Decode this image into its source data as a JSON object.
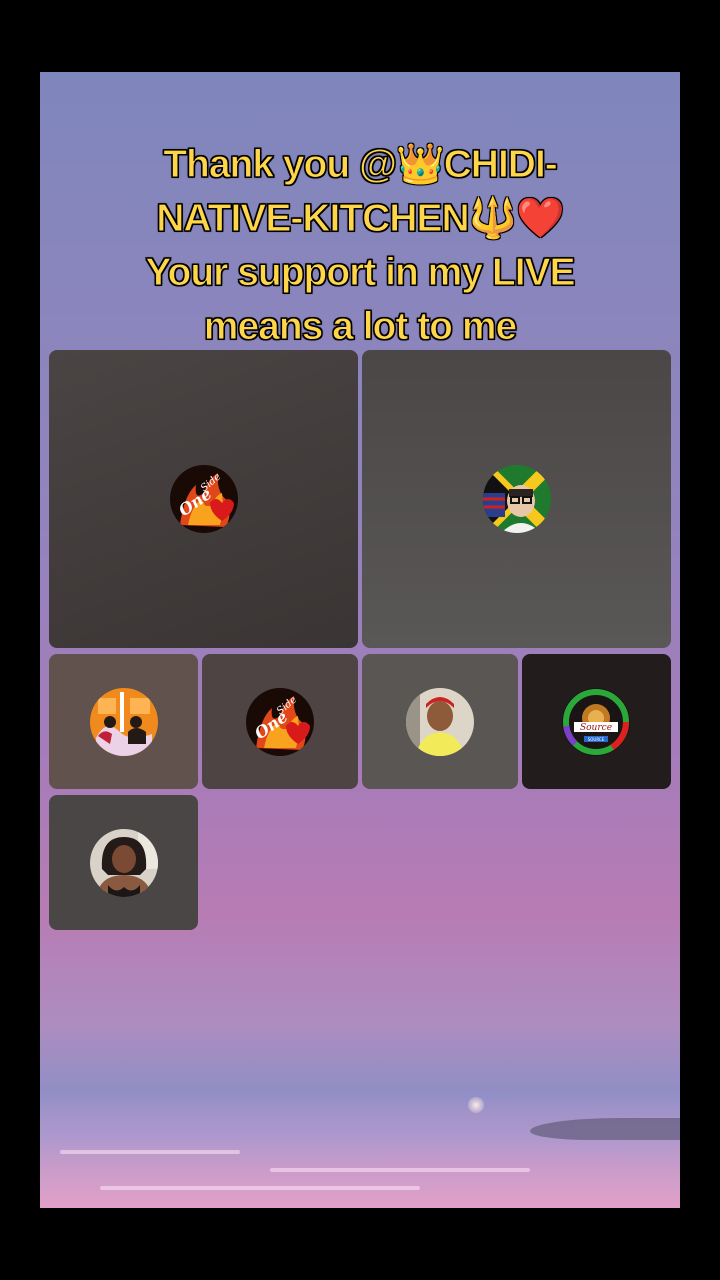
{
  "banner": {
    "line1": "Thank you @👑CHIDI-",
    "line2": "NATIVE-KITCHEN🔱❤️",
    "line3": "Your support in my LIVE",
    "line4": "means a lot to me"
  },
  "guests": [
    {
      "avatar_icon": "one-side-flame-heart-avatar",
      "size": "large"
    },
    {
      "avatar_icon": "flag-portrait-avatar",
      "size": "large"
    },
    {
      "avatar_icon": "couple-silhouette-avatar",
      "size": "small"
    },
    {
      "avatar_icon": "one-side-flame-heart-avatar",
      "size": "small"
    },
    {
      "avatar_icon": "selfie-portrait-avatar",
      "size": "small"
    },
    {
      "avatar_icon": "source-lion-badge-avatar",
      "size": "small"
    },
    {
      "avatar_icon": "woman-portrait-avatar",
      "size": "small"
    }
  ],
  "colors": {
    "banner_text": "#ffd64a",
    "banner_outline": "#000000",
    "tile_dark": "#3c3838"
  }
}
